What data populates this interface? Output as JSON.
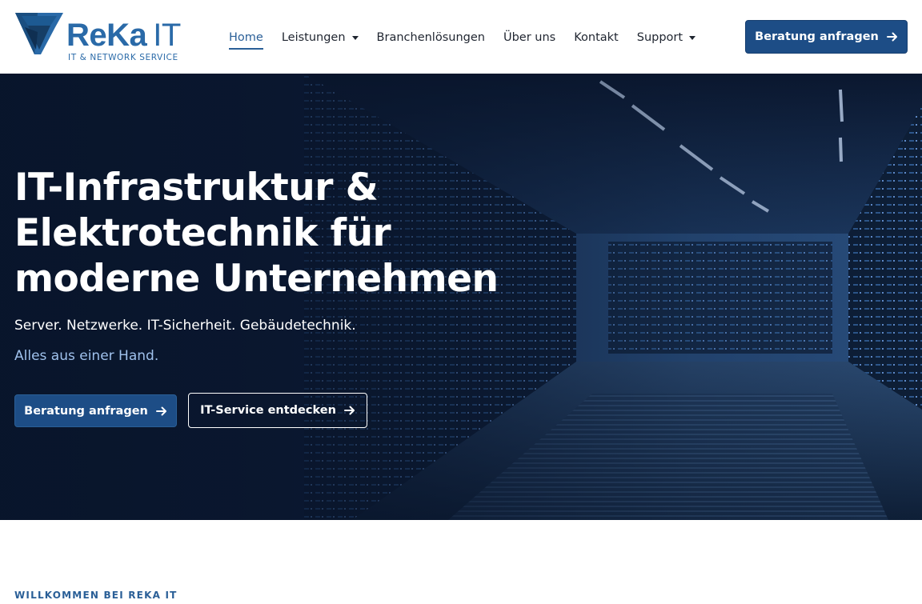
{
  "brand": {
    "name": "ReKa",
    "name_suffix": "IT",
    "tagline": "IT & NETWORK SERVICE",
    "color": "#2a6aa8"
  },
  "nav": {
    "items": [
      {
        "label": "Home",
        "active": true,
        "dropdown": false
      },
      {
        "label": "Leistungen",
        "active": false,
        "dropdown": true
      },
      {
        "label": "Branchenlösungen",
        "active": false,
        "dropdown": false
      },
      {
        "label": "Über uns",
        "active": false,
        "dropdown": false
      },
      {
        "label": "Kontakt",
        "active": false,
        "dropdown": false
      },
      {
        "label": "Support",
        "active": false,
        "dropdown": true
      }
    ],
    "cta_label": "Beratung anfragen",
    "cta_icon": "arrow-right-icon"
  },
  "hero": {
    "title_line1": "IT-Infrastruktur &",
    "title_line2": "Elektrotechnik für",
    "title_line3": "moderne Unternehmen",
    "subtitle": "Server. Netzwerke. IT-Sicherheit. Gebäudetechnik.",
    "tagline": "Alles aus einer Hand.",
    "primary_button": "Beratung anfragen",
    "secondary_button": "IT-Service entdecken",
    "background": "server-room-image"
  },
  "intro": {
    "eyebrow": "WILLKOMMEN BEI REKA IT"
  },
  "colors": {
    "primary": "#1d4d86",
    "accent_text": "#9fc1ec",
    "hero_dark": "#0c1a33"
  }
}
